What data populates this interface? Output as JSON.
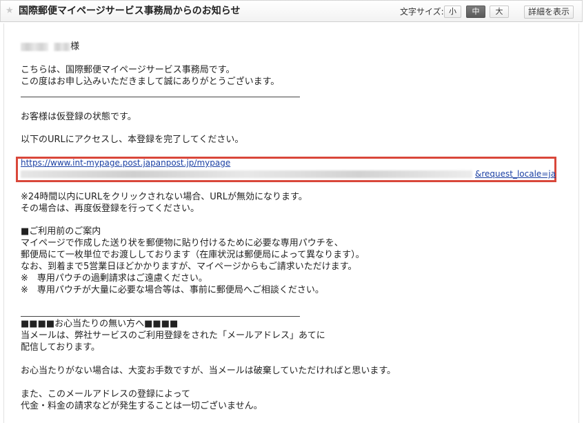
{
  "header": {
    "star_icon": "star-icon",
    "subject": "国際郵便マイページサービス事務局からのお知らせ",
    "font_size_label": "文字サイズ:",
    "font_size_options": [
      "小",
      "中",
      "大"
    ],
    "font_size_selected": "中",
    "details_button": "詳細を表示"
  },
  "email": {
    "salutation_suffix": "様",
    "intro": [
      "こちらは、国際郵便マイページサービス事務局です。",
      "この度はお申し込みいただきまして誠にありがとうございます。"
    ],
    "status": "お客様は仮登録の状態です。",
    "instruction": "以下のURLにアクセスし、本登録を完了してください。",
    "url_line1": "https://www.int-mypage.post.japanpost.jp/mypage",
    "url_line2_suffix": "&request_locale=ja",
    "expiry": [
      "※24時間以内にURLをクリックされない場合、URLが無効になります。",
      "その場合は、再度仮登録を行ってください。"
    ],
    "notice": [
      "■ご利用前のご案内",
      "マイページで作成した送り状を郵便物に貼り付けるために必要な専用パウチを、",
      "郵便局にて一枚単位でお渡ししております（在庫状況は郵便局によって異なります）。",
      "なお、到着まで5営業日ほどかかりますが、マイページからもご請求いただけます。",
      "※　専用パウチの過剰請求はご遠慮ください。",
      "※　専用パウチが大量に必要な場合等は、事前に郵便局へご相談ください。"
    ],
    "unrelated": [
      "■■■■お心当たりの無い方へ■■■■",
      "当メールは、弊社サービスのご利用登録をされた「メールアドレス」あてに",
      "配信しております。"
    ],
    "apology": "お心当たりがない場合は、大変お手数ですが、当メールは破棄していただければと思います。",
    "closing": [
      "また、このメールアドレスの登録によって",
      "代金・料金の請求などが発生することは一切ございません。"
    ]
  }
}
